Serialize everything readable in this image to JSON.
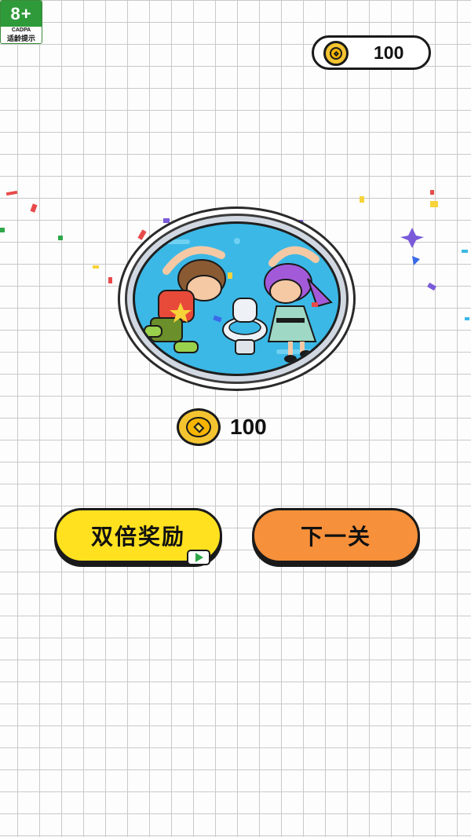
{
  "age_rating": {
    "label": "8+",
    "org": "CADPA",
    "caption": "适龄提示"
  },
  "coins": {
    "icon": "coin-icon",
    "balance": "100"
  },
  "result": {
    "image": "level-complete-illustration",
    "reward_icon": "coin-icon",
    "reward_amount": "100"
  },
  "buttons": {
    "double_reward": "双倍奖励",
    "double_reward_icon": "video-play-icon",
    "next_level": "下一关"
  },
  "colors": {
    "double_button": "#ffe11f",
    "next_button": "#f7903a",
    "coin": "#f4c430",
    "scene_water": "#3bb8e6"
  }
}
